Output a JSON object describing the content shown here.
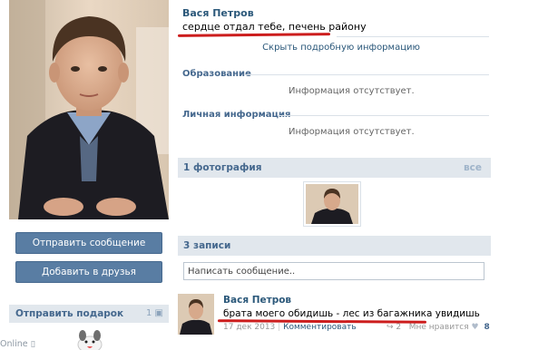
{
  "profile": {
    "name": "Вася Петров",
    "status": "сердце отдал тебе, печень району",
    "more_info_link": "Скрыть подробную информацию"
  },
  "sections": [
    {
      "title": "Образование",
      "value": "Информация отсутствует."
    },
    {
      "title": "Личная информация",
      "value": "Информация отсутствует."
    }
  ],
  "actions": {
    "send_message": "Отправить сообщение",
    "add_friend": "Добавить в друзья"
  },
  "gifts": {
    "title": "Отправить подарок",
    "count": "1"
  },
  "photos": {
    "title": "1 фотография",
    "all_link": "все"
  },
  "wall": {
    "title": "3 записи",
    "placeholder": "Написать сообщение.."
  },
  "post": {
    "author": "Вася Петров",
    "text": "брата моего обидишь - лес из багажника увидишь",
    "date": "17 дек 2013",
    "comment_link": "Комментировать",
    "share_count": "2",
    "like_label": "Мне нравится",
    "like_count": "8",
    "online": "Online"
  },
  "colors": {
    "link": "#2b587a",
    "button": "#597da3",
    "section_bg": "#e1e7ed",
    "annotation_red": "#cc1d1d"
  }
}
